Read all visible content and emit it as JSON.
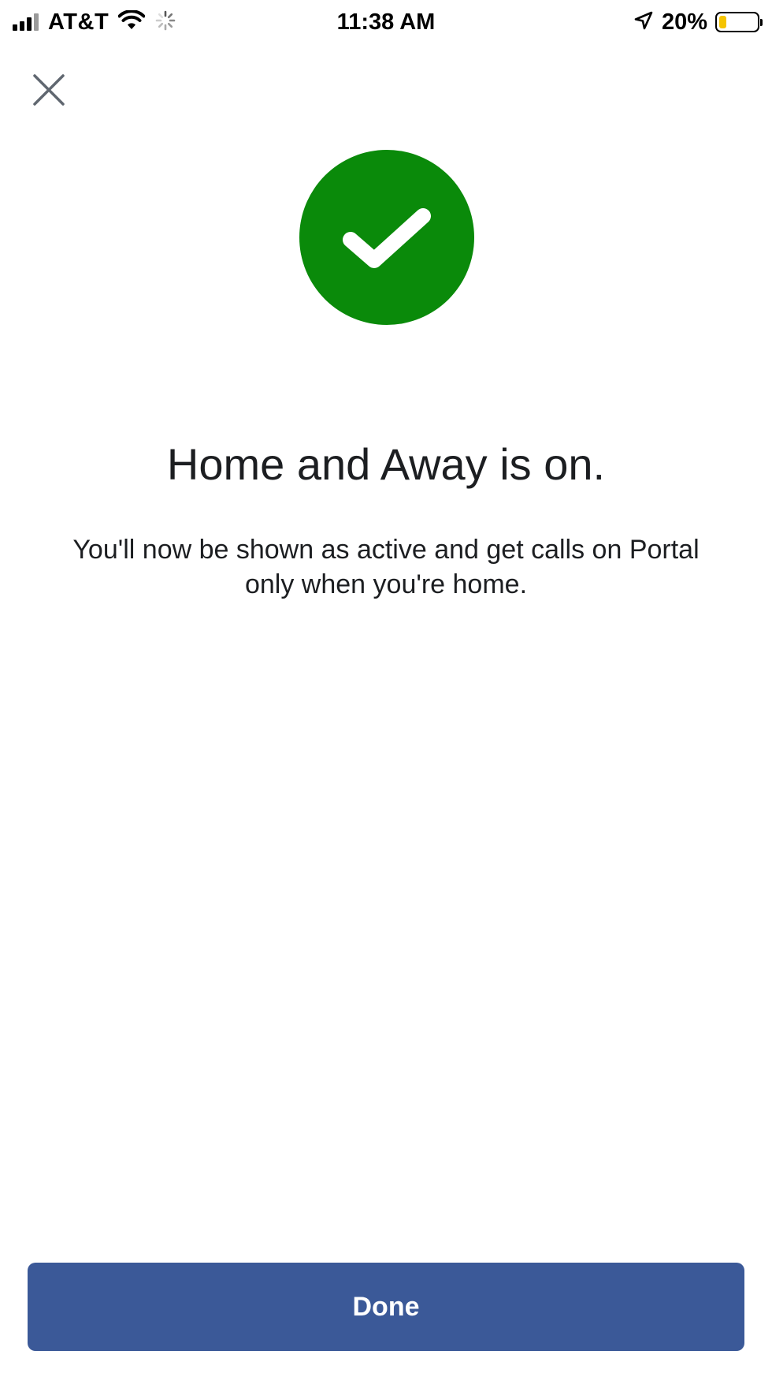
{
  "status_bar": {
    "carrier": "AT&T",
    "time": "11:38 AM",
    "battery_percent": "20%",
    "battery_level": 0.2,
    "icons": [
      "signal-icon",
      "wifi-icon",
      "activity-spinner-icon",
      "location-arrow-icon",
      "battery-icon"
    ]
  },
  "header": {
    "close_icon": "close-icon"
  },
  "success": {
    "icon": "checkmark-icon",
    "circle_color": "#0a8a0a",
    "title": "Home and Away is on.",
    "message": "You'll now be shown as active and get calls on Portal only when you're home."
  },
  "footer": {
    "done_label": "Done",
    "button_color": "#3b5998"
  }
}
